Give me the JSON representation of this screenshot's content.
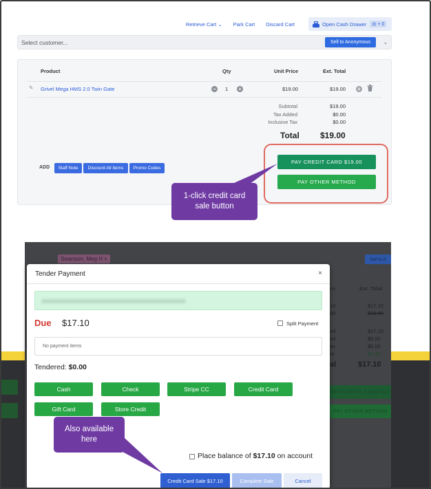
{
  "top": {
    "nav": {
      "retrieve_cart": "Retrieve Cart",
      "park_cart": "Park Cart",
      "discard_cart": "Discard Cart",
      "open_cash_drawer": "Open Cash Drawer",
      "cash_badge": "⚖ + 0"
    },
    "customer": {
      "placeholder": "Select customer...",
      "sell_button": "Sell to Anonymous"
    },
    "cart": {
      "headers": {
        "product": "Product",
        "qty": "Qty",
        "unit_price": "Unit Price",
        "ext_total": "Ext. Total"
      },
      "item": {
        "name": "Grivel Mega HMS 2.0 Twin Gate",
        "qty": "1",
        "unit_price": "$19.00",
        "ext_total": "$19.00"
      },
      "summary": {
        "subtotal_label": "Subtotal",
        "subtotal": "$19.00",
        "tax_added_label": "Tax Added",
        "tax_added": "$0.00",
        "inclusive_tax_label": "Inclusive Tax",
        "inclusive_tax": "$0.00",
        "total_label": "Total",
        "total": "$19.00"
      }
    },
    "add": {
      "label": "ADD",
      "staff_note": "Staff Note",
      "discount_all": "Discount All Items",
      "promo_codes": "Promo Codes"
    },
    "pay_credit_card": "PAY CREDIT CARD  $19.00",
    "pay_other": "PAY OTHER METHOD"
  },
  "callouts": {
    "one_click": "1-click credit card sale button",
    "also_available": "Also available here"
  },
  "background": {
    "customer_chip": "Swanson, Meg H  ×",
    "sell_partial": "Sell to A",
    "ext_total": "Ext. Total",
    "col_prefix": "ce",
    "values": [
      "$17.10",
      "$19.00",
      "$17.10",
      "$0.00",
      "$0.00",
      "$1.90"
    ],
    "row_prefixes": [
      "10",
      "00",
      "ed",
      "ed",
      "ax",
      "nt"
    ],
    "total_suffix": "al",
    "total": "$17.10",
    "pay_cc_partial": "PAY CREDIT CARD  $17",
    "pay_other_partial": "PAY OTHER METHOD"
  },
  "modal": {
    "title": "Tender Payment",
    "close": "×",
    "due_label": "Due",
    "due_amount": "$17.10",
    "split_payment": "Split Payment",
    "no_payment_items": "No payment items",
    "tendered_label": "Tendered:",
    "tendered_amount": "$0.00",
    "methods": [
      "Cash",
      "Check",
      "Stripe CC",
      "Credit Card"
    ],
    "methods_row2": [
      "Gift Card",
      "Store Credit"
    ],
    "balance_prefix": "Place balance of",
    "balance_amount": "$17.10",
    "balance_suffix": "on account",
    "credit_card_sale": "Credit Card Sale $17.10",
    "complete_sale": "Complete Sale",
    "cancel": "Cancel"
  },
  "colors": {
    "primary_blue": "#2f6be0",
    "pay_green_dark": "#17925d",
    "pay_green": "#27a94d",
    "highlight_red": "#e06a5f",
    "callout_purple": "#6f3ba3",
    "due_red": "#d23b32",
    "banner_green": "#d4f5e0"
  }
}
